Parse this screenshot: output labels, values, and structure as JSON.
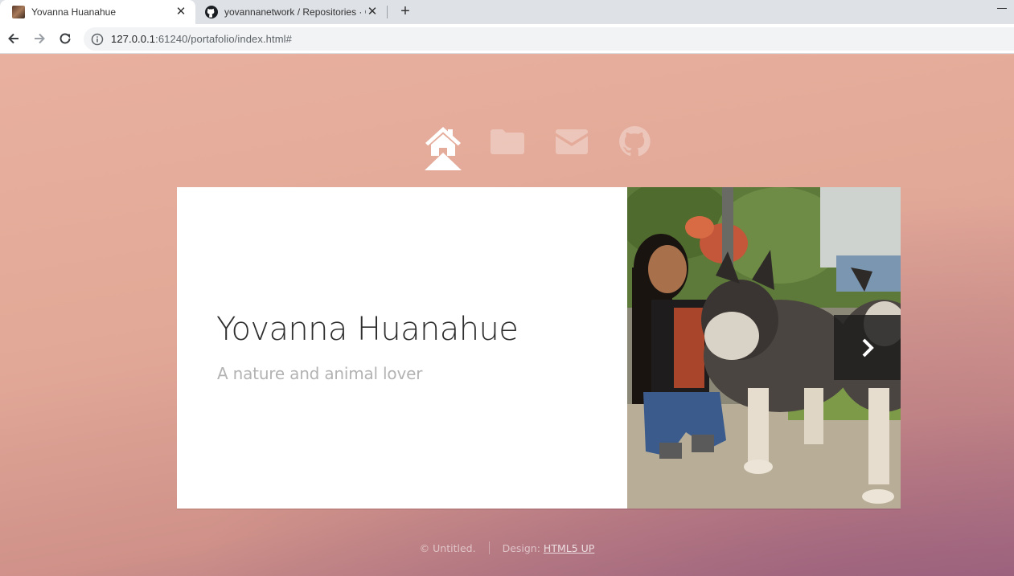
{
  "browser": {
    "tabs": [
      {
        "title": "Yovanna Huanahue",
        "active": true,
        "icon": "profile-photo-favicon"
      },
      {
        "title": "yovannanetwork / Repositories · G",
        "active": false,
        "icon": "github-icon"
      }
    ],
    "close_glyph": "✕",
    "new_tab_glyph": "+",
    "url_host": "127.0.0.1",
    "url_rest": ":61240/portafolio/index.html#"
  },
  "nav": {
    "items": [
      {
        "icon": "home-icon",
        "active": true
      },
      {
        "icon": "folder-icon",
        "active": false
      },
      {
        "icon": "mail-icon",
        "active": false
      },
      {
        "icon": "github-icon",
        "active": false
      }
    ]
  },
  "intro": {
    "title": "Yovanna Huanahue",
    "subtitle": "A nature and animal lover"
  },
  "photo": {
    "icon": "next-arrow-icon"
  },
  "footer": {
    "copyright": "© Untitled.",
    "design_label": "Design:",
    "design_link": "HTML5 UP"
  },
  "colors": {
    "page_background": "#e2a897",
    "panel": "#ffffff",
    "title": "#2e2e2e",
    "subtitle": "#b3b3b3"
  }
}
